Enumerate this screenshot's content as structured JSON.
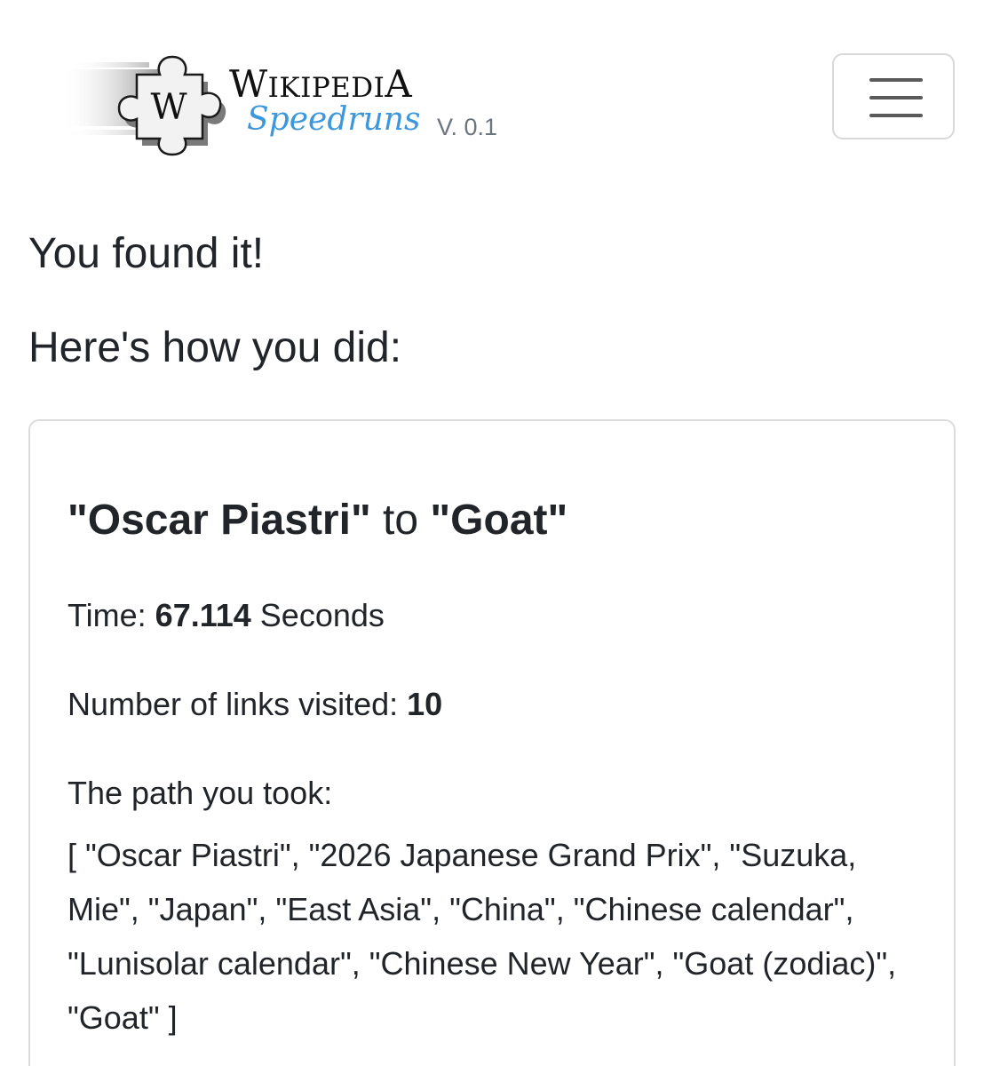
{
  "brand": {
    "logo_letter": "W",
    "title_w": "W",
    "title_rest": "IKIPEDI",
    "title_a": "A",
    "subtitle": "Speedruns",
    "version": "V. 0.1"
  },
  "header": {
    "menu_icon": "hamburger-menu-icon"
  },
  "result": {
    "heading": "You found it!",
    "subheading": "Here's how you did:"
  },
  "card": {
    "from_article": "\"Oscar Piastri\"",
    "connector": " to ",
    "to_article": "\"Goat\"",
    "time_label": "Time: ",
    "time_value": "67.114",
    "time_unit": " Seconds",
    "links_label": "Number of links visited: ",
    "links_value": "10",
    "path_label": "The path you took:",
    "path_text": "[ \"Oscar Piastri\", \"2026 Japanese Grand Prix\", \"Suzuka, Mie\", \"Japan\", \"East Asia\", \"China\", \"Chinese calendar\", \"Lunisolar calendar\", \"Chinese New Year\", \"Goat (zodiac)\", \"Goat\" ]"
  },
  "colors": {
    "accent": "#3d97dc",
    "text": "#212529",
    "muted": "#6c757d",
    "border": "#dcdcdc"
  }
}
